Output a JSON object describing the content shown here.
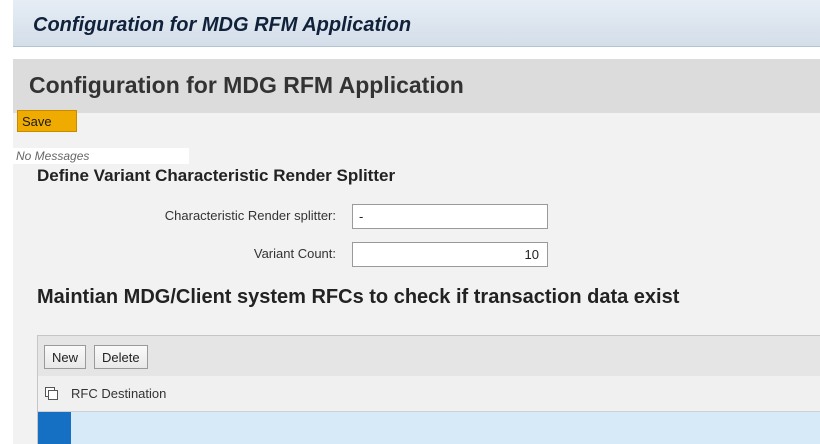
{
  "window": {
    "title": "Configuration for MDG RFM Application"
  },
  "app": {
    "title": "Configuration for MDG RFM Application",
    "toolbar": {
      "save_label": "Save"
    },
    "message_area": {
      "text": "No Messages"
    }
  },
  "splitter_section": {
    "title": "Define Variant Characteristic Render Splitter",
    "fields": {
      "render_splitter": {
        "label": "Characteristic Render splitter:",
        "value": "-"
      },
      "variant_count": {
        "label": "Variant Count:",
        "value": "10"
      }
    }
  },
  "rfc_section": {
    "title": "Maintian MDG/Client system RFCs to check if transaction data exist",
    "toolbar": {
      "new_label": "New",
      "delete_label": "Delete"
    },
    "table": {
      "columns": [
        "RFC Destination"
      ],
      "rows": [
        {
          "rfc_destination": "",
          "selected": true
        }
      ]
    }
  },
  "colors": {
    "save_button": "#f0ab00",
    "selected_row": "#d6eaf8",
    "row_selector": "#1570c4"
  },
  "icons": {
    "select_all": "select-all-icon"
  }
}
